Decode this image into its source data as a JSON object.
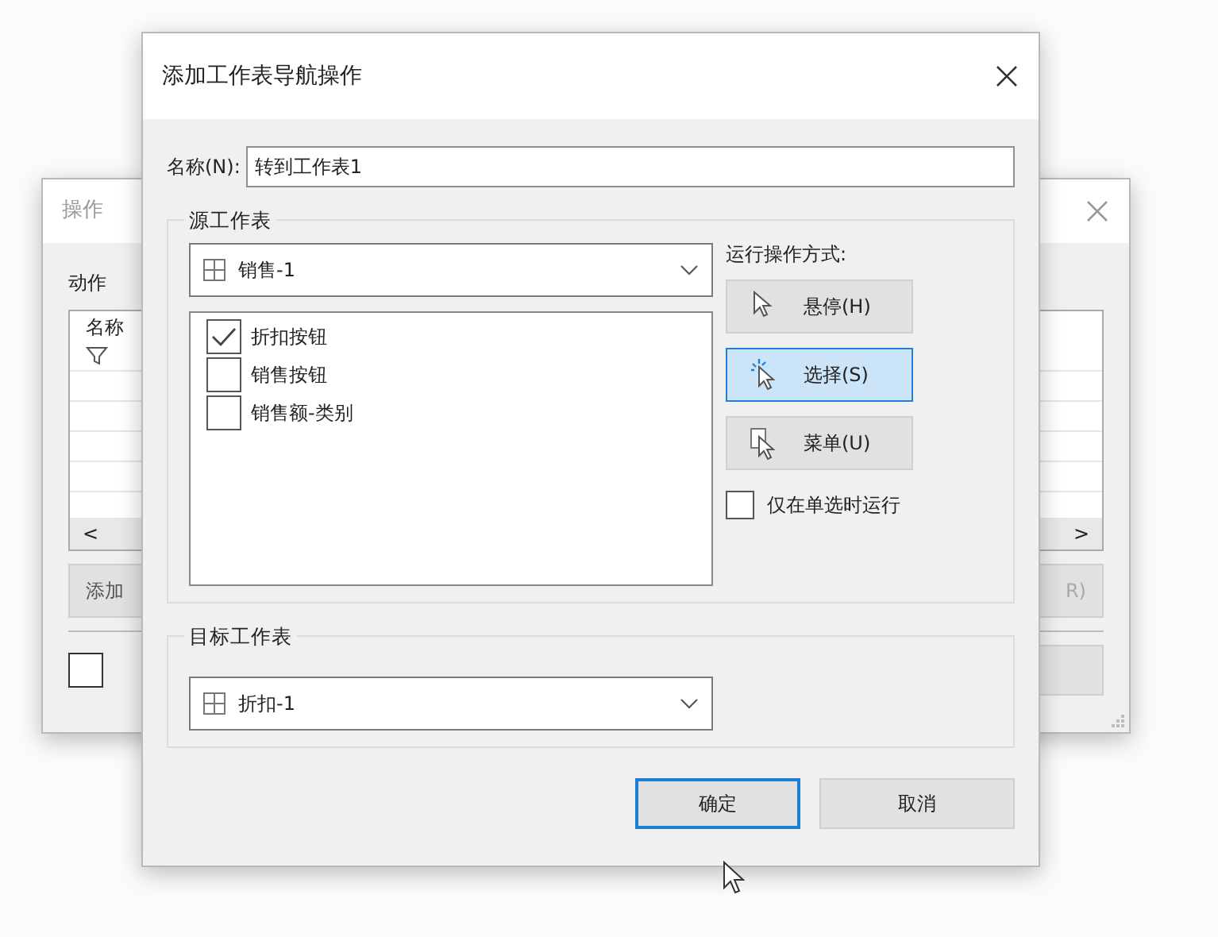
{
  "background_window": {
    "title": "操作",
    "section_label": "动作",
    "column_header": "名称",
    "scroll_left": "<",
    "scroll_right": ">",
    "left_button": "添加",
    "right_button_fragment": "R)",
    "checkbox_checked": false
  },
  "dialog": {
    "title": "添加工作表导航操作",
    "name_label": "名称(N):",
    "name_value": "转到工作表1",
    "source": {
      "legend": "源工作表",
      "sheet": "销售-1",
      "items": [
        {
          "label": "折扣按钮",
          "checked": true
        },
        {
          "label": "销售按钮",
          "checked": false
        },
        {
          "label": "销售额-类别",
          "checked": false
        }
      ]
    },
    "run_mode": {
      "label": "运行操作方式:",
      "options": [
        {
          "label": "悬停(H)",
          "kind": "hover",
          "selected": false
        },
        {
          "label": "选择(S)",
          "kind": "select",
          "selected": true
        },
        {
          "label": "菜单(U)",
          "kind": "menu",
          "selected": false
        }
      ]
    },
    "single_select_only": {
      "label": "仅在单选时运行",
      "checked": false
    },
    "target": {
      "legend": "目标工作表",
      "sheet": "折扣-1"
    },
    "buttons": [
      {
        "label": "确定",
        "default": true
      },
      {
        "label": "取消",
        "default": false
      }
    ]
  }
}
